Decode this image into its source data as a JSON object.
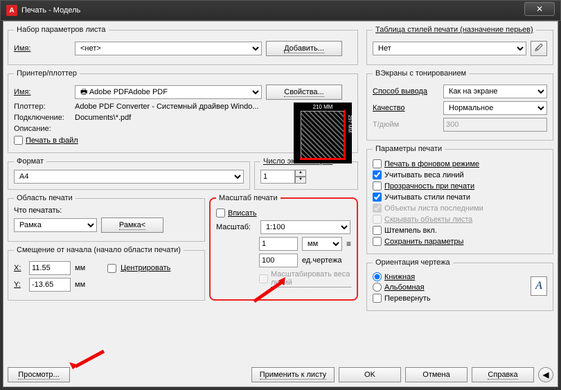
{
  "title": "Печать - Модель",
  "page_setup": {
    "legend": "Набор параметров листа",
    "name_label": "Имя:",
    "name_value": "<нет>",
    "add_btn": "Добавить..."
  },
  "printer": {
    "legend": "Принтер/плоттер",
    "name_label": "Имя:",
    "name_value": "Adobe PDF",
    "props_btn": "Свойства...",
    "plotter_label": "Плоттер:",
    "plotter_value": "Adobe PDF Converter - Системный драйвер Windo...",
    "where_label": "Подключение:",
    "where_value": "Documents\\*.pdf",
    "desc_label": "Описание:",
    "to_file": "Печать в файл",
    "dim_w": "210 MM",
    "dim_h": "297 MM"
  },
  "paper": {
    "legend": "Формат",
    "value": "A4"
  },
  "copies": {
    "legend": "Число экземпляров",
    "value": "1"
  },
  "area": {
    "legend": "Область печати",
    "what_label": "Что печатать:",
    "what_value": "Рамка",
    "window_btn": "Рамка<"
  },
  "offset": {
    "legend": "Смещение от начала (начало области печати)",
    "x_label": "X:",
    "x_value": "11.55",
    "y_label": "Y:",
    "y_value": "-13.65",
    "unit": "мм",
    "center": "Центрировать"
  },
  "scale": {
    "legend": "Масштаб печати",
    "fit": "Вписать",
    "scale_label": "Масштаб:",
    "scale_value": "1:100",
    "num": "1",
    "num_unit": "мм",
    "den": "100",
    "den_unit": "ед.чертежа",
    "weights": "Масштабировать веса линий"
  },
  "styles": {
    "legend": "Таблица стилей печати (назначение перьев)",
    "value": "Нет"
  },
  "shaded": {
    "legend": "ВЭкраны с тонированием",
    "mode_label": "Способ вывода",
    "mode_value": "Как на экране",
    "quality_label": "Качество",
    "quality_value": "Нормальное",
    "dpi_label": "Т/дюйм",
    "dpi_value": "300"
  },
  "options": {
    "legend": "Параметры печати",
    "bg": "Печать в фоновом режиме",
    "lw": "Учитывать веса линий",
    "tr": "Прозрачность при печати",
    "st": "Учитывать стили печати",
    "ps": "Объекты листа последними",
    "hide": "Скрывать объекты листа",
    "stamp": "Штемпель вкл.",
    "save": "Сохранить параметры"
  },
  "orient": {
    "legend": "Ориентация чертежа",
    "port": "Книжная",
    "land": "Альбомная",
    "upside": "Перевернуть"
  },
  "buttons": {
    "preview": "Просмотр...",
    "apply": "Применить к листу",
    "ok": "OK",
    "cancel": "Отмена",
    "help": "Справка"
  }
}
